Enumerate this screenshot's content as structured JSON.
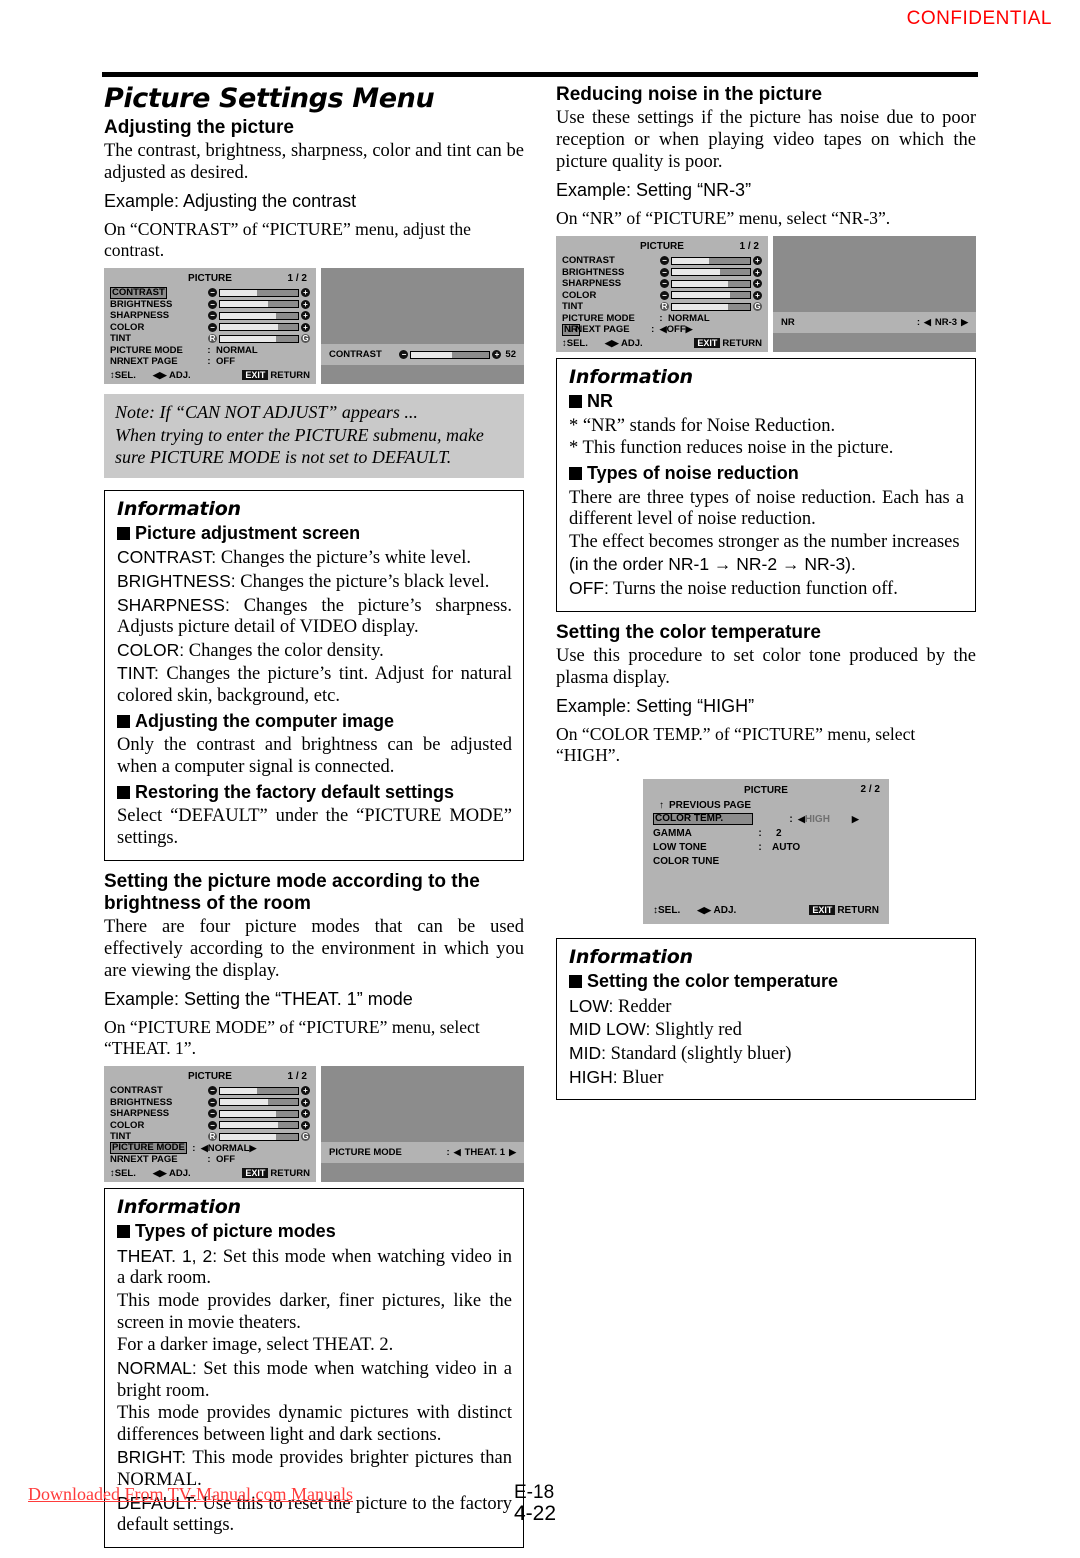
{
  "header": {
    "confidential": "CONFIDENTIAL"
  },
  "footer": {
    "watermark": "Downloaded From TV-Manual.com Manuals",
    "page_e": "E-18",
    "page_b": "4-22"
  },
  "left": {
    "title": "Picture Settings Menu",
    "s1": {
      "heading": "Adjusting the picture",
      "body": "The contrast, brightness, sharpness, color and tint can be adjusted as desired.",
      "example": "Example: Adjusting the contrast",
      "lead": "On “CONTRAST” of “PICTURE” menu, adjust the contrast."
    },
    "note": {
      "label": "Note:",
      "line1": " If “CAN NOT ADJUST” appears ...",
      "line2": "When trying to enter the PICTURE submenu, make sure PICTURE MODE is not set to DEFAULT."
    },
    "info1": {
      "title": "Information",
      "sub1": "Picture adjustment screen",
      "p1_term": "CONTRAST:",
      "p1": " Changes the picture’s white level.",
      "p2_term": "BRIGHTNESS:",
      "p2": " Changes the picture’s black level.",
      "p3_term": "SHARPNESS:",
      "p3": " Changes the picture’s sharpness. Adjusts picture detail of VIDEO display.",
      "p4_term": "COLOR:",
      "p4": " Changes the color density.",
      "p5_term": "TINT:",
      "p5": " Changes the picture’s tint. Adjust for natural colored skin, background, etc.",
      "sub2": "Adjusting the computer image",
      "p6": "Only the contrast and brightness can be adjusted when a computer signal is connected.",
      "sub3": "Restoring the factory default settings",
      "p7": "Select “DEFAULT” under the “PICTURE MODE” settings."
    },
    "s2": {
      "heading": "Setting the picture mode according to the brightness of the room",
      "body": "There are four picture modes that can be used effectively according to the environment in which you are viewing the display.",
      "example": "Example: Setting the “THEAT. 1” mode",
      "lead": "On “PICTURE MODE” of “PICTURE” menu, select “THEAT. 1”."
    },
    "info2": {
      "title": "Information",
      "sub1": "Types of picture modes",
      "p1_term": "THEAT. 1, 2:",
      "p1": " Set this mode when watching video in a dark room.",
      "p2": "This mode provides darker, finer pictures, like the screen in movie theaters.",
      "p3": "For a darker image, select THEAT. 2.",
      "p4_term": "NORMAL:",
      "p4": " Set this mode when watching video in a bright room.",
      "p5": "This mode provides dynamic pictures with distinct differences between light and dark sections.",
      "p6_term": "BRIGHT:",
      "p6": " This mode provides brighter pictures than NORMAL.",
      "p7_term": "DEFAULT:",
      "p7": " Use this to reset the picture to the factory default settings."
    }
  },
  "right": {
    "s1": {
      "heading": "Reducing noise in the picture",
      "body": "Use these settings if the picture has noise due to poor reception or when playing video tapes on which the picture quality is poor.",
      "example": "Example: Setting “NR-3”",
      "lead": "On “NR” of “PICTURE” menu, select “NR-3”."
    },
    "info1": {
      "title": "Information",
      "sub1": "NR",
      "p1": "* “NR” stands for Noise Reduction.",
      "p2": "* This function reduces noise in the picture.",
      "sub2": "Types of noise reduction",
      "p3": "There are three types of noise reduction. Each has a different level of noise reduction.",
      "p4": "The effect becomes stronger as the number increases",
      "p4b": "(in the order NR-1 → NR-2 → NR-3).",
      "p5_term": "OFF:",
      "p5": " Turns the noise reduction function off."
    },
    "s2": {
      "heading": "Setting the color temperature",
      "body": "Use this procedure to set color tone produced by the plasma display.",
      "example": "Example: Setting “HIGH”",
      "lead": "On “COLOR TEMP.” of “PICTURE” menu, select “HIGH”."
    },
    "info2": {
      "title": "Information",
      "sub1": "Setting the color temperature",
      "p1_term": "LOW:",
      "p1": " Redder",
      "p2_term": "MID LOW:",
      "p2": " Slightly red",
      "p3_term": "MID:",
      "p3": " Standard (slightly bluer)",
      "p4_term": "HIGH:",
      "p4": " Bluer"
    }
  },
  "osd": {
    "common": {
      "title": "PICTURE",
      "page_1of2": "1 / 2",
      "page_2of2": "2 / 2",
      "contrast": "CONTRAST",
      "brightness": "BRIGHTNESS",
      "sharpness": "SHARPNESS",
      "color": "COLOR",
      "tint": "TINT",
      "picture_mode": "PICTURE MODE",
      "nr": "NR",
      "next_page": "NEXT PAGE",
      "previous_page": "PREVIOUS PAGE",
      "sel": "SEL.",
      "adj": "ADJ.",
      "exit": "EXIT",
      "return": "RETURN",
      "colon": ":",
      "minus": "−",
      "plus": "+",
      "r": "R",
      "g": "G",
      "up_arrow": "↑",
      "down_arrow": "↓",
      "left_arrow": "◀",
      "right_arrow": "▶",
      "updown_arrow": "↕"
    },
    "m1": {
      "picture_mode_val": "NORMAL",
      "nr_val": "OFF",
      "detail_label": "CONTRAST",
      "detail_value": "52"
    },
    "m2": {
      "picture_mode_val": "NORMAL",
      "nr_val": "OFF",
      "detail_label": "PICTURE MODE",
      "detail_value": "THEAT. 1"
    },
    "m3": {
      "picture_mode_val": "NORMAL",
      "nr_val": "OFF",
      "detail_label": "NR",
      "detail_value": "NR-3"
    },
    "m4": {
      "color_temp": "COLOR TEMP.",
      "color_temp_val": "HIGH",
      "gamma": "GAMMA",
      "gamma_val": "2",
      "low_tone": "LOW TONE",
      "low_tone_val": "AUTO",
      "color_tune": "COLOR TUNE"
    }
  }
}
